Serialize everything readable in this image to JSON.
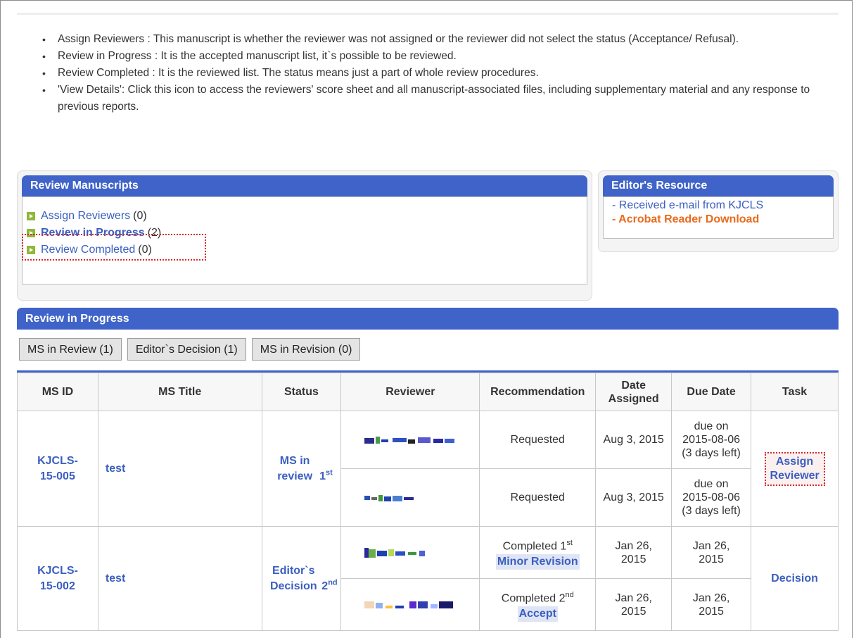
{
  "notes": [
    "Assign Reviewers : This manuscript is whether the reviewer was not assigned or the reviewer did not select the status (Acceptance/ Refusal).",
    "Review in Progress : It is the accepted manuscript list, it`s possible to be reviewed.",
    "Review Completed : It is the reviewed list. The status means just a part of whole review procedures.",
    "'View Details': Click this icon to access the reviewers' score sheet and all manuscript-associated files, including supplementary material and any response to previous reports."
  ],
  "review_manuscripts": {
    "title": "Review Manuscripts",
    "items": [
      {
        "label": "Assign Reviewers",
        "count": "(0)"
      },
      {
        "label": "Review in Progress",
        "count": "(2)"
      },
      {
        "label": "Review Completed",
        "count": "(0)"
      }
    ]
  },
  "editors_resource": {
    "title": "Editor's Resource",
    "links": [
      "- Received e-mail from KJCLS",
      "- Acrobat Reader Download"
    ]
  },
  "review_in_progress": {
    "title": "Review in Progress",
    "tabs": [
      "MS in Review (1)",
      "Editor`s Decision (1)",
      "MS in Revision (0)"
    ],
    "columns": [
      "MS ID",
      "MS Title",
      "Status",
      "Reviewer",
      "Recommendation",
      "Date Assigned",
      "Due Date",
      "Task"
    ],
    "rows": [
      {
        "ms_id": "KJCLS-15-005",
        "ms_title": "test",
        "status": "MS in review",
        "status_ord": "1",
        "status_sup": "st",
        "task": "Assign Reviewer",
        "reviewers": [
          {
            "recommendation": "Requested",
            "date_assigned": "Aug 3, 2015",
            "due_line1": "due on",
            "due_line2": "2015-08-06",
            "due_line3": "(3 days left)"
          },
          {
            "recommendation": "Requested",
            "date_assigned": "Aug 3, 2015",
            "due_line1": "due on",
            "due_line2": "2015-08-06",
            "due_line3": "(3 days left)"
          }
        ]
      },
      {
        "ms_id": "KJCLS-15-002",
        "ms_title": "test",
        "status": "Editor`s Decision",
        "status_ord": "2",
        "status_sup": "nd",
        "task": "Decision",
        "reviewers": [
          {
            "recommendation": "Completed 1",
            "rec_sup": "st",
            "rec_result": "Minor Revision",
            "date_assigned": "Jan 26, 2015",
            "due_date": "Jan 26, 2015"
          },
          {
            "recommendation": "Completed 2",
            "rec_sup": "nd",
            "rec_result": "Accept",
            "date_assigned": "Jan 26, 2015",
            "due_date": "Jan 26, 2015"
          }
        ]
      }
    ]
  },
  "colors": {
    "panel_header": "#3f63c9",
    "link": "#3b5fc0",
    "highlight": "#d62a2a",
    "orange_link": "#e86a1c"
  }
}
